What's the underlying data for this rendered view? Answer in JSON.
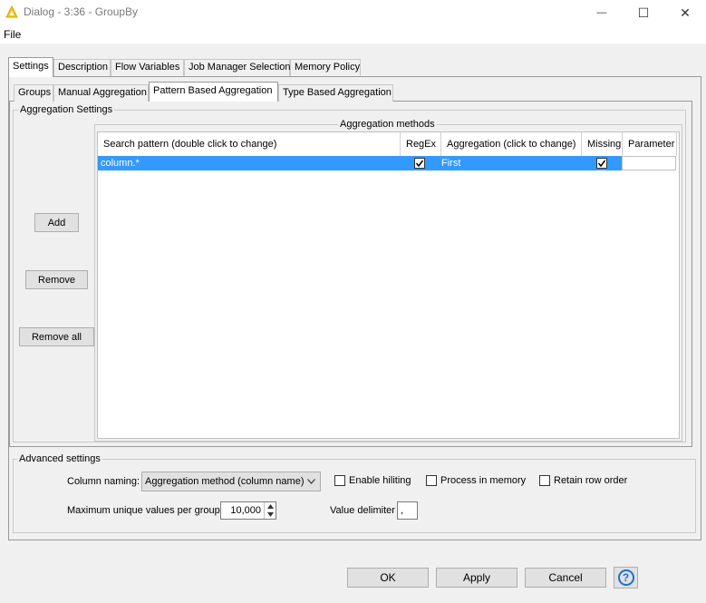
{
  "window": {
    "title": "Dialog - 3:36 - GroupBy",
    "minimize_glyph": "—",
    "maximize_glyph": "☐",
    "close_glyph": "✕"
  },
  "menu": {
    "file": "File"
  },
  "outer_tabs": [
    "Settings",
    "Description",
    "Flow Variables",
    "Job Manager Selection",
    "Memory Policy"
  ],
  "inner_tabs": [
    "Groups",
    "Manual Aggregation",
    "Pattern Based Aggregation",
    "Type Based Aggregation"
  ],
  "aggregation_settings": {
    "legend": "Aggregation Settings",
    "methods_legend": "Aggregation methods",
    "add": "Add",
    "remove": "Remove",
    "remove_all": "Remove all",
    "columns": [
      "Search pattern (double click to change)",
      "RegEx",
      "Aggregation (click to change)",
      "Missing",
      "Parameter"
    ],
    "rows": [
      {
        "pattern": "column.*",
        "regex": true,
        "aggregation": "First",
        "missing": true,
        "parameter": ""
      }
    ]
  },
  "advanced": {
    "legend": "Advanced settings",
    "column_naming_label": "Column naming:",
    "column_naming_value": "Aggregation method (column name)",
    "enable_hiliting": "Enable hiliting",
    "process_in_memory": "Process in memory",
    "retain_row_order": "Retain row order",
    "max_unique_label": "Maximum unique values per group",
    "max_unique_value": "10,000",
    "value_delimiter_label": "Value delimiter",
    "value_delimiter_value": ","
  },
  "footer": {
    "ok": "OK",
    "apply": "Apply",
    "cancel": "Cancel",
    "help_glyph": "?"
  },
  "colors": {
    "selection": "#3399ff",
    "help": "#1e6fd9",
    "knime_icon": "#f5c518"
  }
}
